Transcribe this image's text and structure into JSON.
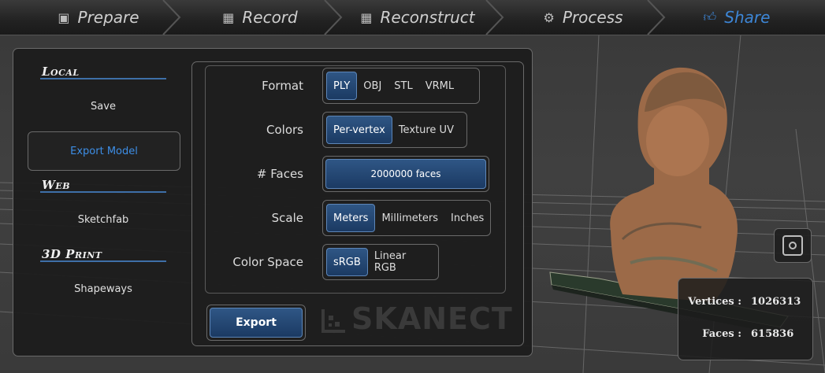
{
  "nav": {
    "tabs": [
      {
        "label": "Prepare",
        "icon": "prepare-icon"
      },
      {
        "label": "Record",
        "icon": "film-icon"
      },
      {
        "label": "Reconstruct",
        "icon": "film-icon"
      },
      {
        "label": "Process",
        "icon": "gears-icon"
      },
      {
        "label": "Share",
        "icon": "thumbs-up-icon"
      }
    ],
    "active_tab": "Share",
    "active_color": "#3d86d6"
  },
  "sidebar": {
    "local_title": "Local",
    "local_items": [
      "Save",
      "Export Model"
    ],
    "web_title": "Web",
    "web_items": [
      "Sketchfab"
    ],
    "print_title": "3D Print",
    "print_items": [
      "Shapeways"
    ],
    "selected_item": "Export Model"
  },
  "export_options": {
    "format": {
      "label": "Format",
      "options": [
        "PLY",
        "OBJ",
        "STL",
        "VRML"
      ],
      "selected": "PLY"
    },
    "colors": {
      "label": "Colors",
      "options": [
        "Per-vertex",
        "Texture UV"
      ],
      "selected": "Per-vertex"
    },
    "faces": {
      "label": "# Faces",
      "value": "2000000 faces"
    },
    "scale": {
      "label": "Scale",
      "options": [
        "Meters",
        "Millimeters",
        "Inches"
      ],
      "selected": "Meters"
    },
    "color_space": {
      "label": "Color Space",
      "options": [
        "sRGB",
        "Linear RGB"
      ],
      "selected": "sRGB"
    }
  },
  "export_button": "Export",
  "logo_text": "SKANECT",
  "stats": {
    "vertices_label": "Vertices :",
    "vertices_value": "1026313",
    "faces_label": "Faces :",
    "faces_value": "615836"
  },
  "colors": {
    "accent": "#3d86d6",
    "button_blue": "#1b3a63"
  }
}
